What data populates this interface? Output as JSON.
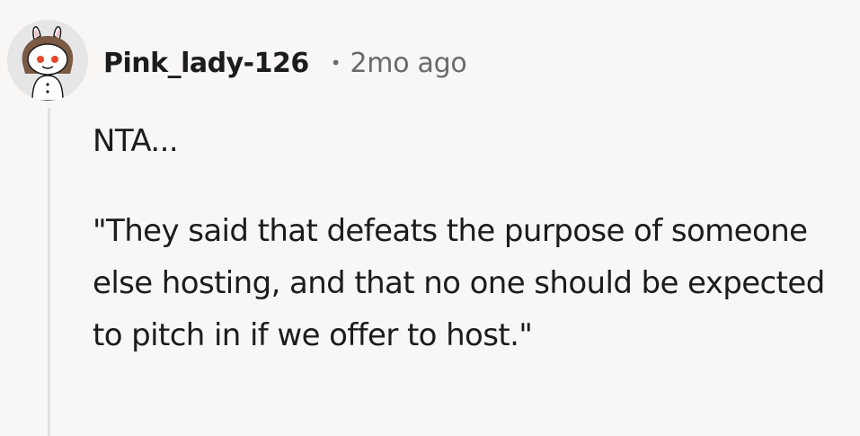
{
  "comment": {
    "author": "Pink_lady-126",
    "separator": "•",
    "timestamp": "2mo ago",
    "avatar_icon": "snoo-bunny-avatar-icon",
    "paragraphs": [
      "NTA...",
      "\"They said that defeats the purpose of someone else hosting, and that no one should be expected to pitch in if we offer to host.\""
    ]
  },
  "colors": {
    "background": "#f8f7f6",
    "text": "#1c1c1c",
    "meta": "#6a6a6a",
    "thread_line": "#e3e1df",
    "avatar_eye": "#e8462a"
  }
}
